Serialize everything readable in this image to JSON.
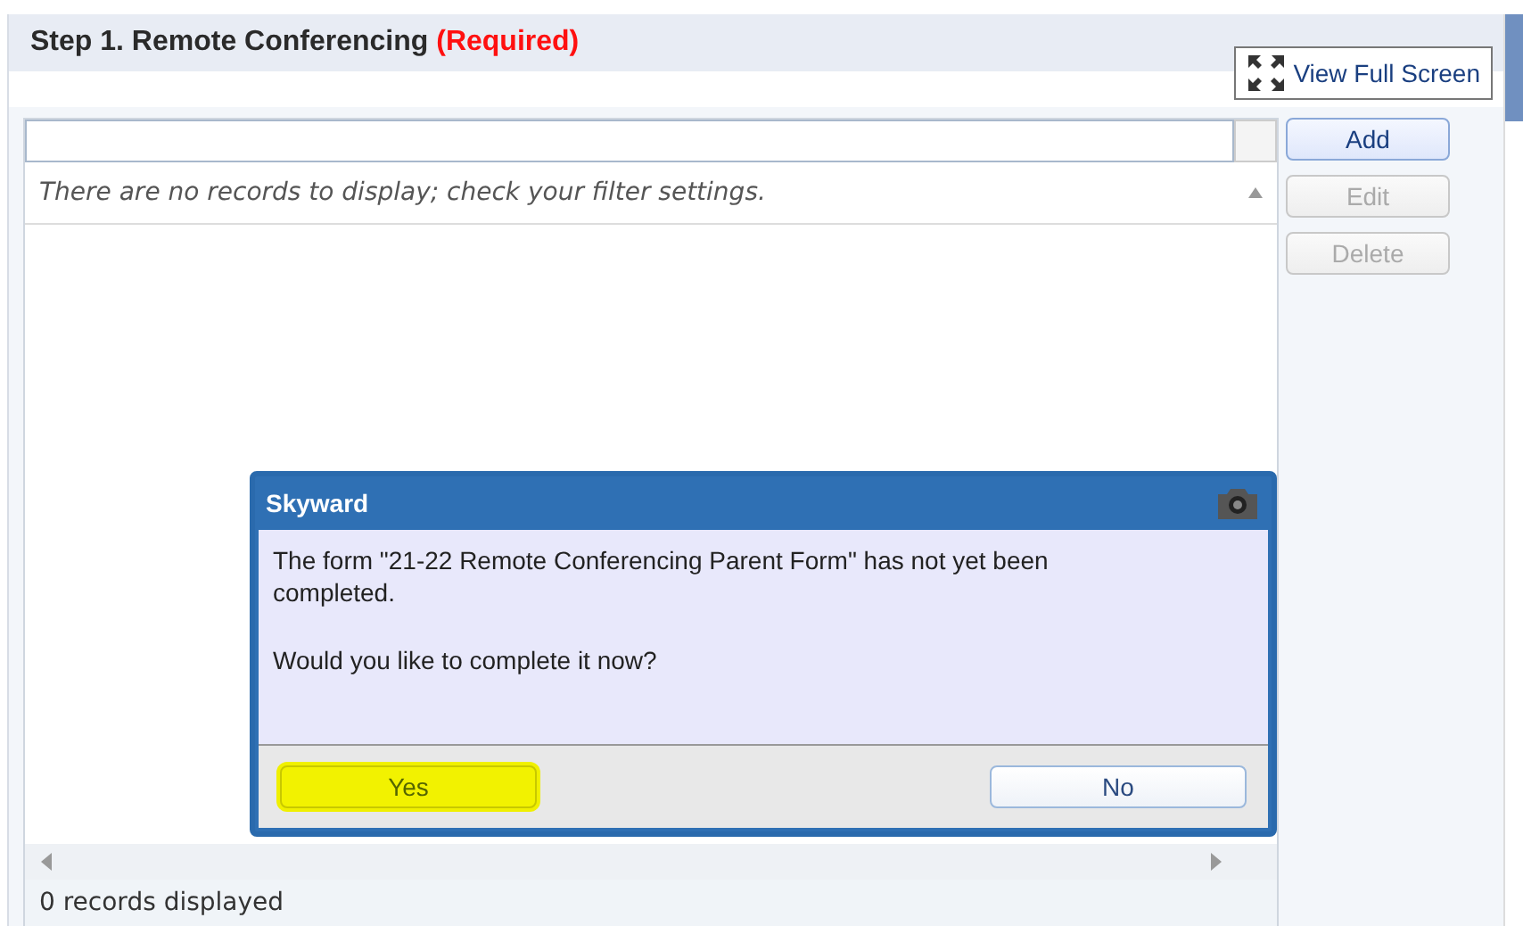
{
  "panel": {
    "title": "Step 1. Remote Conferencing",
    "required_label": "(Required)",
    "full_screen_button": "View Full Screen"
  },
  "grid": {
    "empty_message": "There are no records to display; check your filter settings.",
    "footer": "0 records displayed"
  },
  "side_buttons": [
    {
      "label": "Add",
      "disabled": false
    },
    {
      "label": "Edit",
      "disabled": true
    },
    {
      "label": "Delete",
      "disabled": true
    }
  ],
  "dialog": {
    "title": "Skyward",
    "message": "The form \"21-22 Remote Conferencing Parent Form\" has not yet been completed.",
    "question": "Would you like to complete it now?",
    "buttons": [
      {
        "label": "Yes",
        "highlighted": true
      },
      {
        "label": "No",
        "highlighted": false
      }
    ]
  }
}
